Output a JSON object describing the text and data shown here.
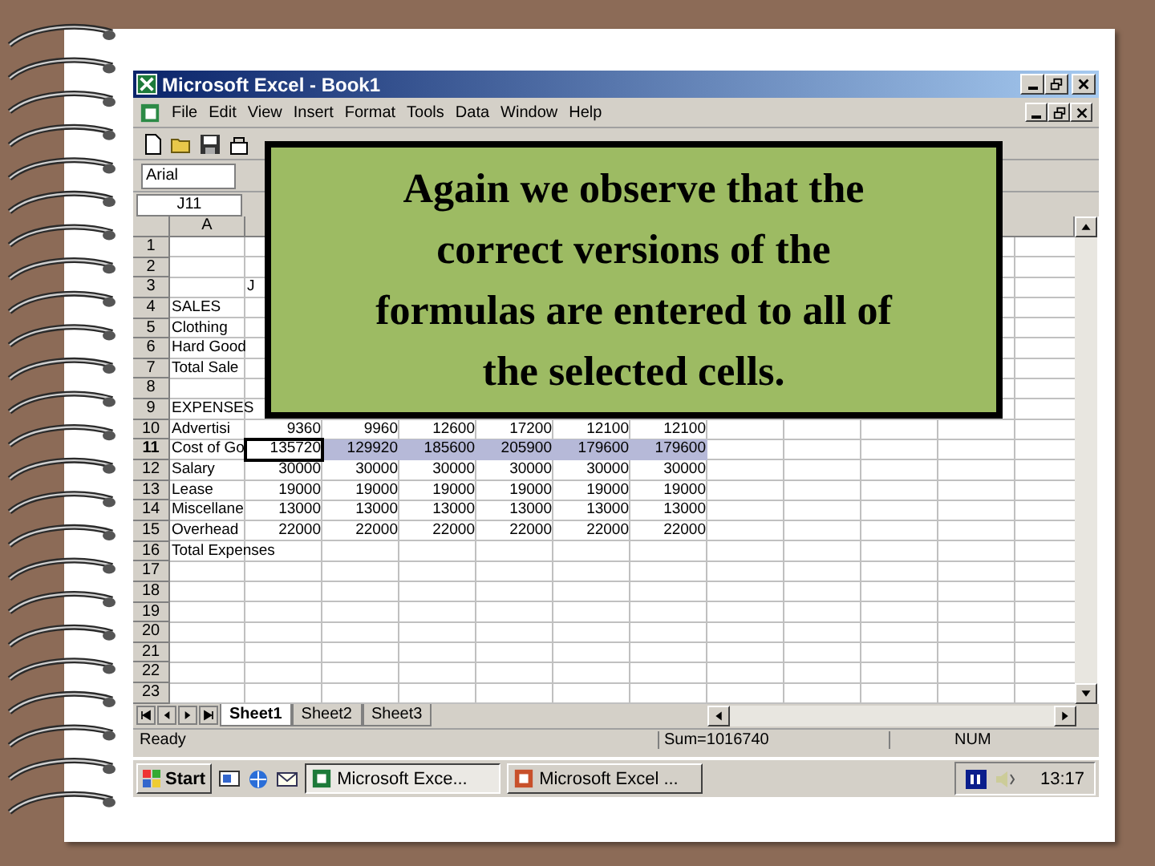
{
  "window": {
    "title": "Microsoft Excel - Book1"
  },
  "menu": [
    "File",
    "Edit",
    "View",
    "Insert",
    "Format",
    "Tools",
    "Data",
    "Window",
    "Help"
  ],
  "font_box": {
    "value": "Arial"
  },
  "name_box": {
    "value": "J11"
  },
  "columns": [
    "A"
  ],
  "rows": [
    {
      "num": "1",
      "selected": false
    },
    {
      "num": "2",
      "selected": false
    },
    {
      "num": "3",
      "selected": false,
      "col_b": "J"
    },
    {
      "num": "4",
      "selected": false,
      "label": "SALES"
    },
    {
      "num": "5",
      "selected": false,
      "label": "Clothing"
    },
    {
      "num": "6",
      "selected": false,
      "label": "Hard Good"
    },
    {
      "num": "7",
      "selected": false,
      "label": "Total Sale"
    },
    {
      "num": "8",
      "selected": false
    },
    {
      "num": "9",
      "selected": false,
      "label": "EXPENSES"
    },
    {
      "num": "10",
      "selected": false,
      "label": "Advertisi",
      "values": [
        "9360",
        "9960",
        "12600",
        "17200",
        "12100",
        "12100"
      ]
    },
    {
      "num": "11",
      "selected": true,
      "label": "Cost of Go",
      "values": [
        "135720",
        "129920",
        "185600",
        "205900",
        "179600",
        "179600"
      ]
    },
    {
      "num": "12",
      "selected": false,
      "label": "Salary",
      "values": [
        "30000",
        "30000",
        "30000",
        "30000",
        "30000",
        "30000"
      ]
    },
    {
      "num": "13",
      "selected": false,
      "label": "Lease",
      "values": [
        "19000",
        "19000",
        "19000",
        "19000",
        "19000",
        "19000"
      ]
    },
    {
      "num": "14",
      "selected": false,
      "label": "Miscellane",
      "values": [
        "13000",
        "13000",
        "13000",
        "13000",
        "13000",
        "13000"
      ]
    },
    {
      "num": "15",
      "selected": false,
      "label": "Overhead",
      "values": [
        "22000",
        "22000",
        "22000",
        "22000",
        "22000",
        "22000"
      ]
    },
    {
      "num": "16",
      "selected": false,
      "label": "Total Expenses"
    },
    {
      "num": "17",
      "selected": false
    },
    {
      "num": "18",
      "selected": false
    },
    {
      "num": "19",
      "selected": false
    },
    {
      "num": "20",
      "selected": false
    },
    {
      "num": "21",
      "selected": false
    },
    {
      "num": "22",
      "selected": false
    },
    {
      "num": "23",
      "selected": false
    }
  ],
  "sheet_tabs": [
    {
      "label": "Sheet1",
      "selected": true
    },
    {
      "label": "Sheet2",
      "selected": false
    },
    {
      "label": "Sheet3",
      "selected": false
    }
  ],
  "status_bar": {
    "mode": "Ready",
    "sum": "Sum=1016740",
    "num": "NUM"
  },
  "taskbar": {
    "start": "Start",
    "tasks": [
      {
        "label": "Microsoft Exce...",
        "selected": true
      },
      {
        "label": "Microsoft Excel ...",
        "selected": false
      }
    ],
    "clock": "13:17"
  },
  "callout": {
    "lines": [
      "Again we observe that the",
      "correct versions of the",
      "formulas are entered to all of",
      "the selected cells."
    ]
  }
}
